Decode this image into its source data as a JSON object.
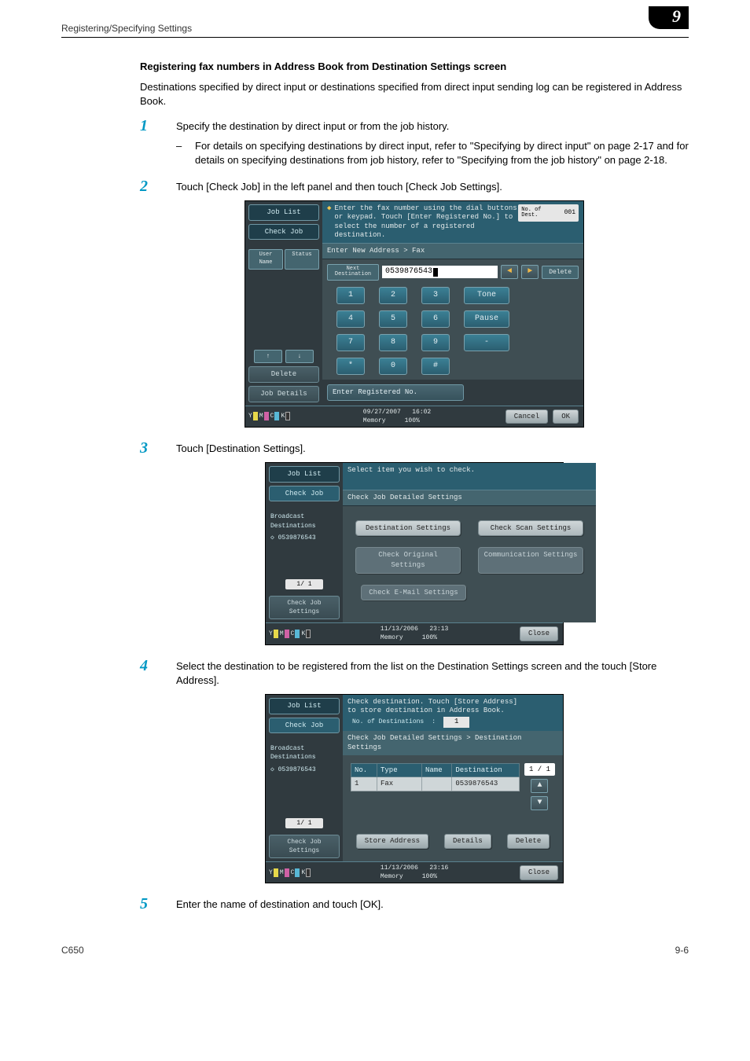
{
  "header": {
    "left": "Registering/Specifying Settings",
    "chapter": "9"
  },
  "section_title": "Registering fax numbers in Address Book from Destination Settings screen",
  "lead": "Destinations specified by direct input or destinations specified from direct input sending log can be registered in Address Book.",
  "steps": {
    "1": {
      "text": "Specify the destination by direct input or from the job history.",
      "sub": "For details on specifying destinations by direct input, refer to \"Specifying by direct input\" on page 2-17 and for details on specifying destinations from job history, refer to \"Specifying from the job history\" on page 2-18."
    },
    "2": {
      "text": "Touch [Check Job] in the left panel and then touch [Check Job Settings]."
    },
    "3": {
      "text": "Touch [Destination Settings]."
    },
    "4": {
      "text": "Select the destination to be registered from the list on the Destination Settings screen and the touch [Store Address]."
    },
    "5": {
      "text": "Enter the name of destination and touch [OK]."
    }
  },
  "panel1": {
    "tab_job_list": "Job List",
    "tab_check_job": "Check Job",
    "side_user_name": "User Name",
    "side_status": "Status",
    "side_up": "↑",
    "side_down": "↓",
    "side_delete": "Delete",
    "side_job_details": "Job Details",
    "banner_text": "Enter the fax number using the dial buttons\nor keypad. Touch [Enter Registered No.] to\nselect the number of a registered destination.",
    "banner_bullet": "◆",
    "no_dest_label": "No. of Dest.",
    "no_dest_value": "001",
    "bar_text": "Enter New Address > Fax",
    "next_dest": "Next Destination",
    "fax_value": "0539876543",
    "delete_btn": "Delete",
    "tone": "Tone",
    "pause": "Pause",
    "dash": "-",
    "keys": {
      "1": "1",
      "2": "2",
      "3": "3",
      "4": "4",
      "5": "5",
      "6": "6",
      "7": "7",
      "8": "8",
      "9": "9",
      "star": "*",
      "0": "0",
      "hash": "#"
    },
    "enter_reg_no": "Enter Registered No.",
    "date": "09/27/2007",
    "time": "16:02",
    "mem_label": "Memory",
    "mem_val": "100%",
    "cancel": "Cancel",
    "ok": "OK"
  },
  "panel2": {
    "tab_job_list": "Job List",
    "tab_check_job": "Check Job",
    "broadcast": "Broadcast Destinations",
    "dest_item": "0539876543",
    "page": "1/  1",
    "check_job_settings": "Check Job Settings",
    "banner_text": "Select item you wish to check.",
    "bar_text": "Check Job Detailed Settings",
    "btn_dest_settings": "Destination Settings",
    "btn_scan_settings": "Check Scan Settings",
    "btn_check_original": "Check Original Settings",
    "btn_comm": "Communication Settings",
    "btn_email": "Check E-Mail Settings",
    "date": "11/13/2006",
    "time": "23:13",
    "mem_label": "Memory",
    "mem_val": "100%",
    "close": "Close"
  },
  "panel3": {
    "tab_job_list": "Job List",
    "tab_check_job": "Check Job",
    "broadcast": "Broadcast Destinations",
    "dest_item": "0539876543",
    "page_side": "1/  1",
    "check_job_settings": "Check Job Settings",
    "banner_text": "Check destination. Touch [Store Address]\nto store destination in Address Book.",
    "sub_label": "No. of Destinations",
    "sub_colon": ":",
    "sub_value": "1",
    "breadcrumb": "Check Job Detailed Settings > Destination Settings",
    "th_no": "No.",
    "th_type": "Type",
    "th_name": "Name",
    "th_dest": "Destination",
    "row_no": "1",
    "row_type": "Fax",
    "row_name": "",
    "row_dest": "0539876543",
    "page_main": "1 / 1",
    "store": "Store Address",
    "details": "Details",
    "delete": "Delete",
    "date": "11/13/2006",
    "time": "23:16",
    "mem_label": "Memory",
    "mem_val": "100%",
    "close": "Close"
  },
  "ymck": {
    "y": "Y",
    "m": "M",
    "c": "C",
    "k": "K"
  },
  "footer": {
    "left": "C650",
    "right": "9-6"
  }
}
